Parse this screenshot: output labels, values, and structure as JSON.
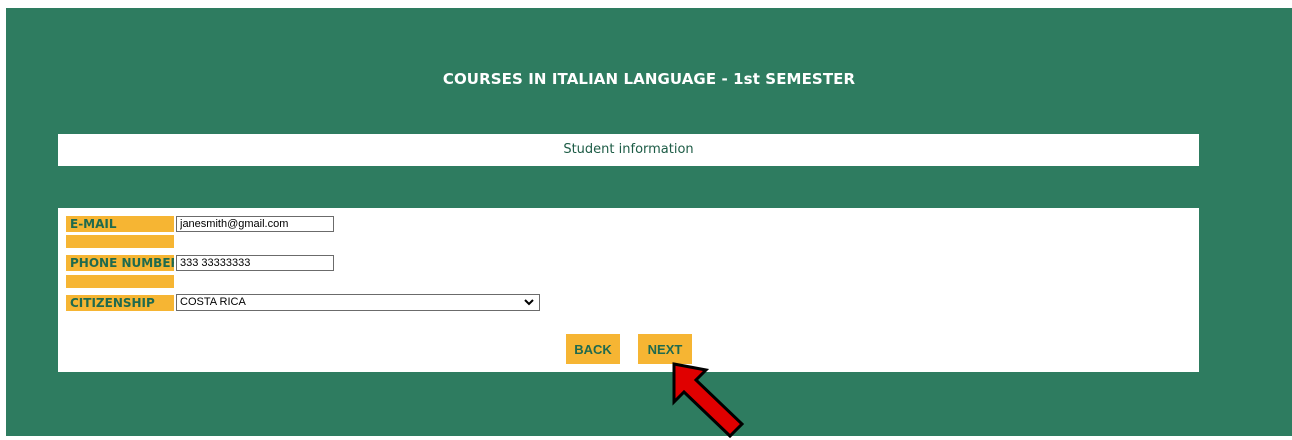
{
  "header": {
    "title": "COURSES IN ITALIAN LANGUAGE - 1st SEMESTER"
  },
  "section": {
    "title": "Student information"
  },
  "form": {
    "email_label": "E-MAIL",
    "email_value": "janesmith@gmail.com",
    "phone_label": "PHONE NUMBER",
    "phone_value": "333 33333333",
    "citizenship_label": "CITIZENSHIP",
    "citizenship_value": "COSTA RICA"
  },
  "buttons": {
    "back_label": "BACK",
    "next_label": "NEXT"
  },
  "colors": {
    "background": "#2e7c60",
    "label_bg": "#f6b533",
    "label_text": "#1f6a4e",
    "arrow": "#e00000"
  },
  "icons": {
    "dropdown": "chevron-down-icon",
    "pointer": "red-arrow-icon"
  }
}
